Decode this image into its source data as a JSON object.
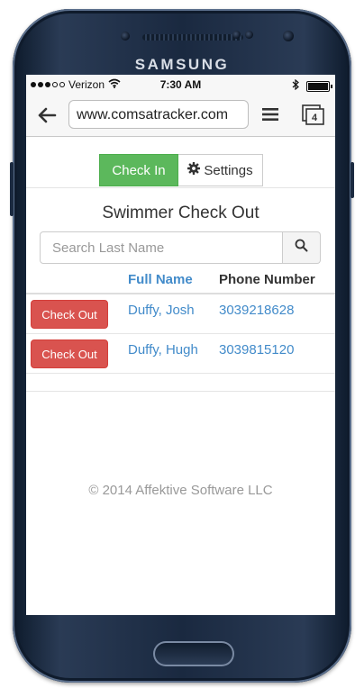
{
  "device": {
    "brand": "SAMSUNG"
  },
  "status_bar": {
    "carrier": "Verizon",
    "time": "7:30 AM",
    "icons": [
      "signal-dots-icon",
      "wifi-icon",
      "bluetooth-icon",
      "battery-icon"
    ]
  },
  "browser": {
    "url": "www.comsatracker.com",
    "tab_count": "4",
    "icons": [
      "back-arrow-icon",
      "menu-icon",
      "tabs-icon"
    ]
  },
  "nav": {
    "checkin_label": "Check In",
    "settings_label": "Settings",
    "settings_icon": "gear-icon",
    "checkin_color": "#5cb85c"
  },
  "page": {
    "title": "Swimmer Check Out",
    "search_placeholder": "Search Last Name",
    "search_icon": "search-icon"
  },
  "table": {
    "headers": [
      "Full Name",
      "Phone Number"
    ],
    "rows": [
      {
        "action": "Check Out",
        "name": "Duffy, Josh",
        "phone": "3039218628"
      },
      {
        "action": "Check Out",
        "name": "Duffy, Hugh",
        "phone": "3039815120"
      }
    ],
    "action_color": "#d9534f",
    "link_color": "#428bca"
  },
  "footer": {
    "text": "© 2014 Affektive Software LLC"
  }
}
